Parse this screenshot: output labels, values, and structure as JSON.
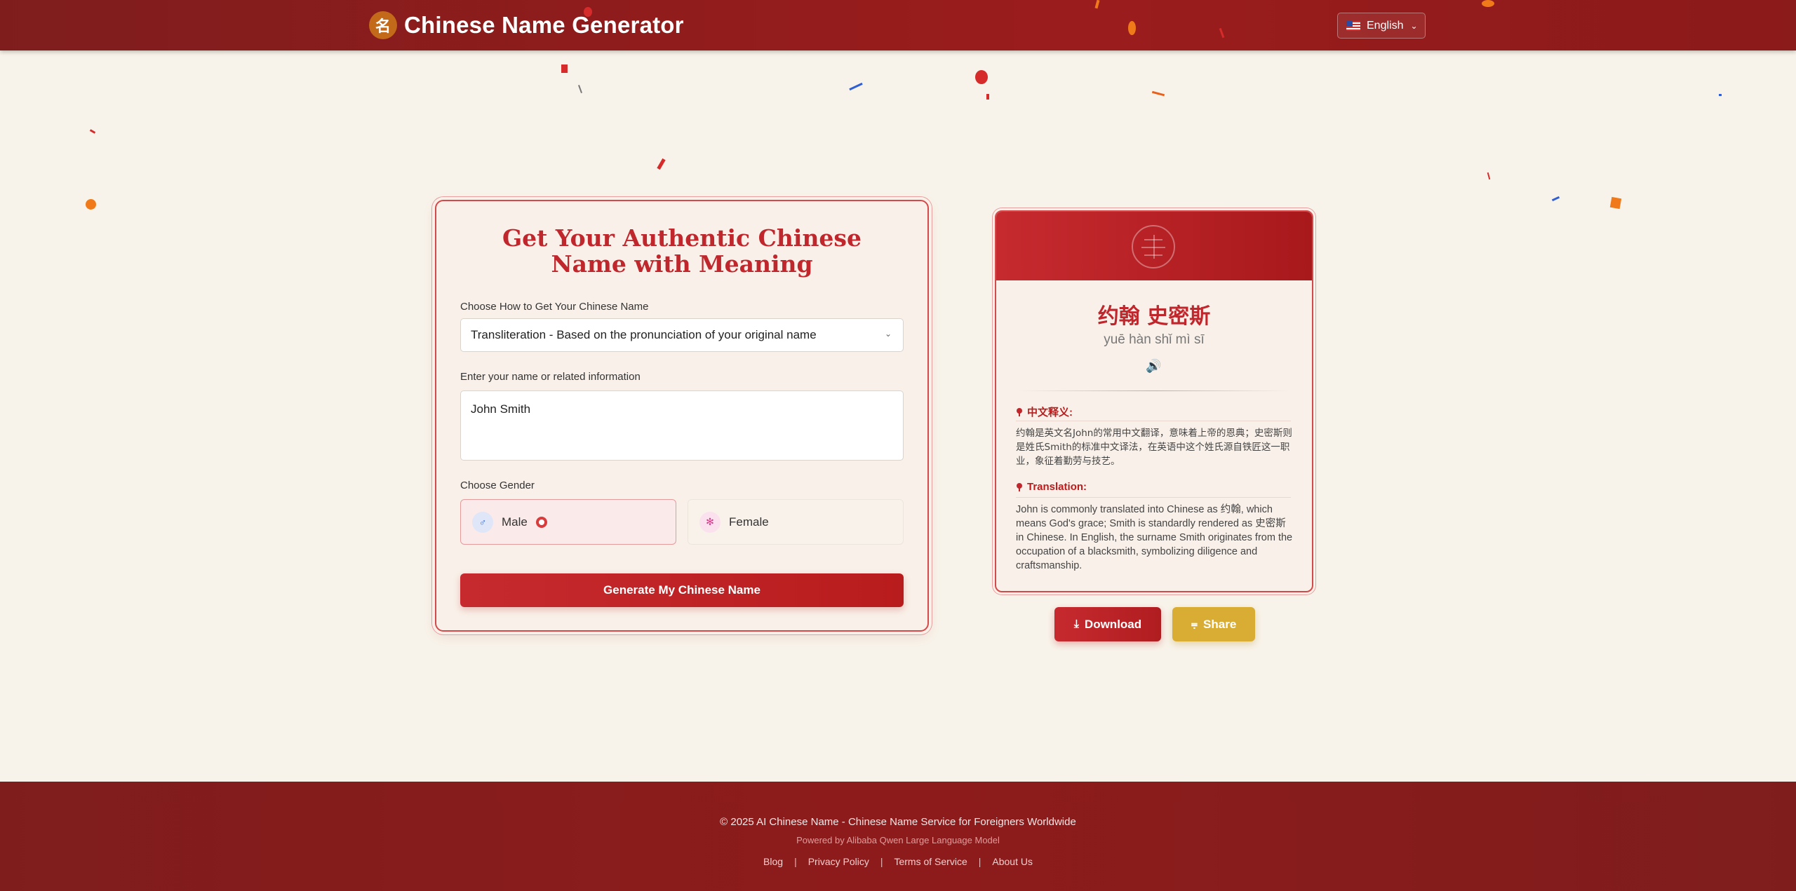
{
  "header": {
    "logo_glyph": "名",
    "title": "Chinese Name Generator",
    "language": "English",
    "language_icon": "us-flag-icon"
  },
  "form": {
    "title": "Get Your Authentic Chinese Name with Meaning",
    "method_label": "Choose How to Get Your Chinese Name",
    "method_value": "Transliteration - Based on the pronunciation of your original name",
    "name_label": "Enter your name or related information",
    "name_value": "John Smith",
    "gender_label": "Choose Gender",
    "gender_options": [
      {
        "label": "Male",
        "selected": true,
        "icon": "male-icon"
      },
      {
        "label": "Female",
        "selected": false,
        "icon": "female-icon"
      }
    ],
    "submit_label": "Generate My Chinese Name"
  },
  "result": {
    "chinese_name": "约翰 史密斯",
    "pinyin": "yuē hàn shǐ mì sī",
    "chinese_meaning_title": "中文释义:",
    "chinese_meaning": "约翰是英文名John的常用中文翻译，意味着上帝的恩典；史密斯则是姓氏Smith的标准中文译法，在英语中这个姓氏源自铁匠这一职业，象征着勤劳与技艺。",
    "translation_title": "Translation:",
    "translation": "John is commonly translated into Chinese as 约翰, which means God's grace; Smith is standardly rendered as 史密斯 in Chinese. In English, the surname Smith originates from the occupation of a blacksmith, symbolizing diligence and craftsmanship.",
    "download_label": "Download",
    "share_label": "Share"
  },
  "footer": {
    "copyright": "© 2025 AI Chinese Name - Chinese Name Service for Foreigners Worldwide",
    "powered": "Powered by Alibaba Qwen Large Language Model",
    "links": [
      "Blog",
      "Privacy Policy",
      "Terms of Service",
      "About Us"
    ],
    "separator": "|"
  },
  "colors": {
    "primary": "#b91c1c",
    "accent_gold": "#d9ac34",
    "background": "#f8f3ea"
  }
}
